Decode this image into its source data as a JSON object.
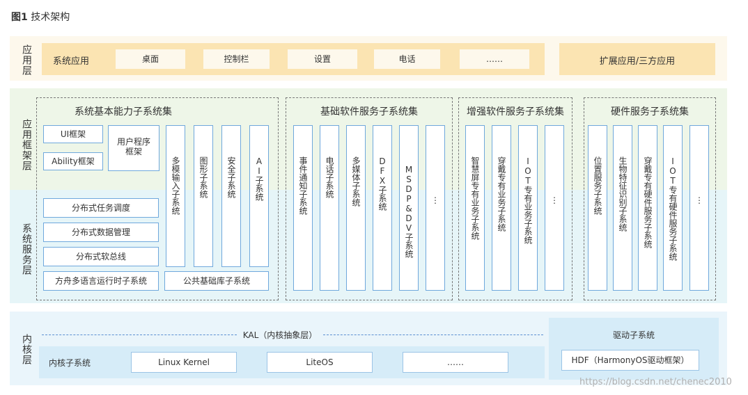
{
  "title_prefix": "图1",
  "title": "技术架构",
  "layers": {
    "app": "应用层",
    "framework": "应用框架层",
    "service": "系统服务层",
    "kernel": "内核层"
  },
  "app_layer": {
    "system_apps_label": "系统应用",
    "items": [
      "桌面",
      "控制栏",
      "设置",
      "电话",
      "……"
    ],
    "extended": "扩展应用/三方应用"
  },
  "groups": {
    "basic_capability": {
      "title": "系统基本能力子系统集",
      "ui_framework": "UI框架",
      "ability_framework": "Ability框架",
      "user_program_framework": "用户程序框架",
      "columns": [
        "多模输入子系统",
        "图形子系统",
        "安全子系统",
        "AI子系统"
      ],
      "distributed": [
        "分布式任务调度",
        "分布式数据管理",
        "分布式软总线"
      ],
      "ark_runtime": "方舟多语言运行时子系统",
      "common_base": "公共基础库子系统"
    },
    "basic_software": {
      "title": "基础软件服务子系统集",
      "columns": [
        "事件通知子系统",
        "电话子系统",
        "多媒体子系统",
        "DFX子系统",
        "MSDP&DV子系统",
        "⋮"
      ]
    },
    "enhanced_software": {
      "title": "增强软件服务子系统集",
      "columns": [
        "智慧屏专有业务子系统",
        "穿戴专有业务子系统",
        "IOT专有业务子系统",
        "⋮"
      ]
    },
    "hardware": {
      "title": "硬件服务子系统集",
      "columns": [
        "位置服务子系统",
        "生物特征识别子系统",
        "穿戴专有硬件服务子系统",
        "IOT专有硬件服务子系统",
        "⋮"
      ]
    }
  },
  "kernel_layer": {
    "kal": "KAL（内核抽象层）",
    "subsystem_label": "内核子系统",
    "items": [
      "Linux Kernel",
      "LiteOS",
      "……"
    ],
    "driver_title": "驱动子系统",
    "hdf": "HDF（HarmonyOS驱动框架）"
  },
  "watermark": "https://blog.csdn.net/chenec2010"
}
